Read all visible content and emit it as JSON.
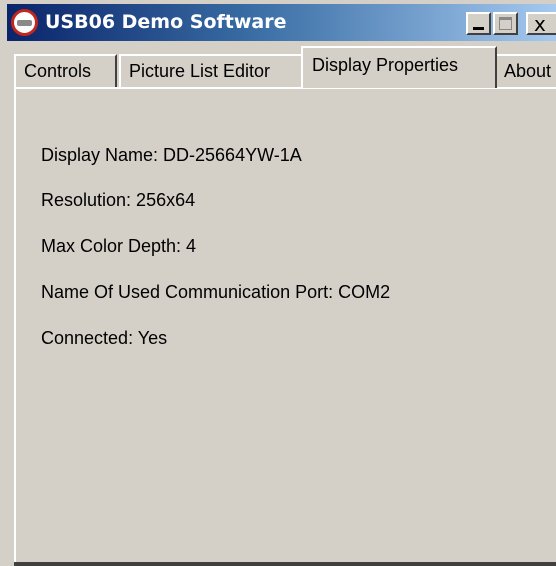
{
  "window": {
    "title": "USB06 Demo Software",
    "icon": "app-logo-icon",
    "controls": {
      "minimize": "minimize-icon",
      "maximize": "maximize-icon",
      "close_glyph": "x"
    }
  },
  "tabs": [
    {
      "label": "Controls",
      "selected": false
    },
    {
      "label": "Picture List Editor",
      "selected": false
    },
    {
      "label": "Display Properties",
      "selected": true
    },
    {
      "label": "About",
      "selected": false
    }
  ],
  "properties": [
    {
      "text": "Display Name: DD-25664YW-1A"
    },
    {
      "text": "Resolution: 256x64"
    },
    {
      "text": "Max Color Depth: 4"
    },
    {
      "text": "Name Of Used Communication Port: COM2"
    },
    {
      "text": "Connected: Yes"
    }
  ],
  "colors": {
    "titlebar_start": "#0a246a",
    "titlebar_end": "#a6caf0",
    "face": "#d4d0c8"
  }
}
